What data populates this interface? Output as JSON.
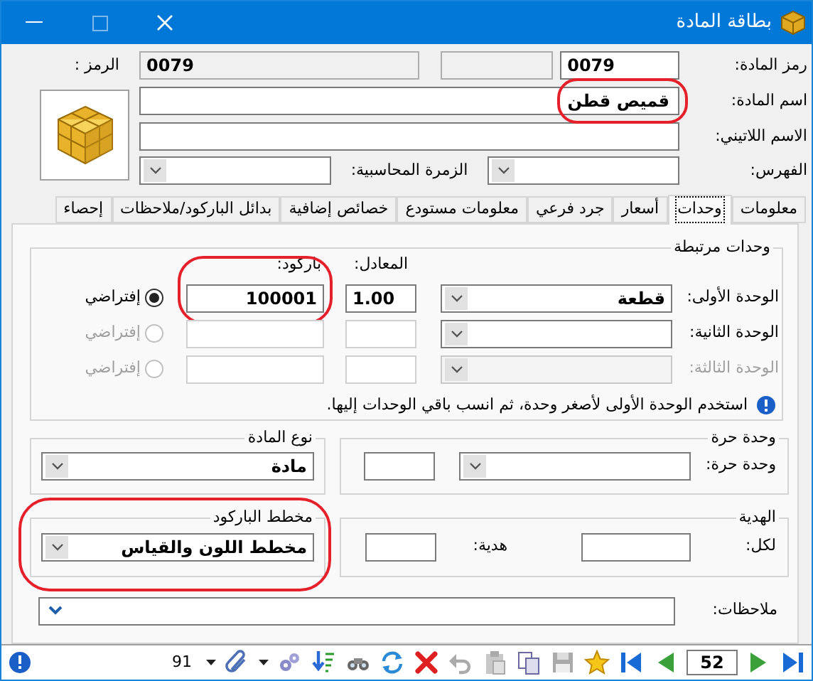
{
  "window": {
    "title": "بطاقة المادة"
  },
  "header": {
    "code_label": "رمز المادة:",
    "code": "0079",
    "symbol_label": "الرمز :",
    "symbol": "0079",
    "name_label": "اسم المادة:",
    "name": "قميص قطن",
    "name_highlighted": true,
    "latin_label": "الاسم اللاتيني:",
    "index_label": "الفهرس:",
    "group_label": "الزمرة المحاسبية:"
  },
  "tabs": [
    {
      "label": "معلومات",
      "selected": false
    },
    {
      "label": "وحدات",
      "selected": true
    },
    {
      "label": "أسعار",
      "selected": false
    },
    {
      "label": "جرد فرعي",
      "selected": false
    },
    {
      "label": "معلومات مستودع",
      "selected": false
    },
    {
      "label": "خصائص إضافية",
      "selected": false
    },
    {
      "label": "بدائل الباركود/ملاحظات",
      "selected": false
    },
    {
      "label": "إحصاء",
      "selected": false
    }
  ],
  "linked_units": {
    "title": "وحدات مرتبطة",
    "factor_label": "المعادل:",
    "barcode_label": "باركود:",
    "barcode_highlighted": true,
    "rows": [
      {
        "label": "الوحدة الأولى:",
        "unit": "قطعة",
        "factor": "1.00",
        "barcode": "100001",
        "default_label": "إفتراضي",
        "selected": true,
        "disabled": false
      },
      {
        "label": "الوحدة الثانية:",
        "default_label": "إفتراضي",
        "selected": false,
        "disabled": false
      },
      {
        "label": "الوحدة الثالثة:",
        "default_label": "إفتراضي",
        "selected": false,
        "disabled": true
      }
    ],
    "note": "استخدم الوحدة الأولى لأصغر وحدة، ثم انسب باقي الوحدات إليها."
  },
  "item_type": {
    "title": "نوع المادة",
    "value": "مادة"
  },
  "free_unit": {
    "title": "وحدة حرة",
    "label": "وحدة حرة:"
  },
  "barcode_scheme": {
    "title": "مخطط الباركود",
    "value": "مخطط اللون والقياس",
    "highlighted": true
  },
  "gift": {
    "title": "الهدية",
    "per_label": "لكل:",
    "gift_label": "هدية:"
  },
  "notes": {
    "label": "ملاحظات:"
  },
  "toolbar": {
    "count": "91",
    "record": "52"
  }
}
